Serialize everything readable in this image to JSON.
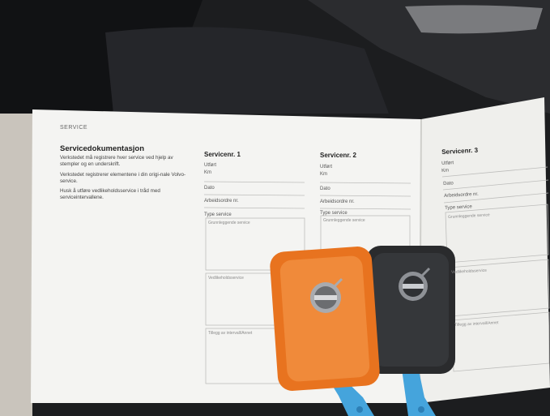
{
  "page": {
    "section_label": "SERVICE",
    "title": "Servicedokumentasjon",
    "intro_paragraphs": [
      "Verkstedet må registrere hver service ved hjelp av stempler og en underskrift.",
      "Verkstedet registrerer elementene i din origi-nale Volvo-service.",
      "Husk å utføre vedlikeholdsservice i tråd med serviceintervallene."
    ]
  },
  "columns": [
    {
      "heading": "Servicenr. 1",
      "fields": [
        "Utført",
        "Km",
        "Dato",
        "Arbeidsordre nr.",
        "Type service"
      ],
      "boxes": [
        "Grunnleggende service",
        "Vedlikeholdsservice",
        "Tillegg av intervall/Annet"
      ]
    },
    {
      "heading": "Servicenr. 2",
      "fields": [
        "Utført",
        "Km",
        "Dato",
        "Arbeidsordre nr.",
        "Type service"
      ],
      "boxes": [
        "Grunnleggende service"
      ]
    },
    {
      "heading": "Servicenr. 3",
      "fields": [
        "Utført",
        "Km",
        "Dato",
        "Arbeidsordre nr.",
        "Type service"
      ],
      "boxes": [
        "Grunnleggende service",
        "Vedlikeholdsservice",
        "Tillegg av intervall/Annet"
      ]
    }
  ],
  "colors": {
    "paper": "#f4f4f2",
    "key_orange": "#e8731f",
    "key_black": "#2a2b2d",
    "strap_blue": "#45a4dc",
    "car_interior": "#1c1d1f"
  },
  "icons": [
    "volvo-emblem-icon",
    "volvo-emblem-icon"
  ]
}
